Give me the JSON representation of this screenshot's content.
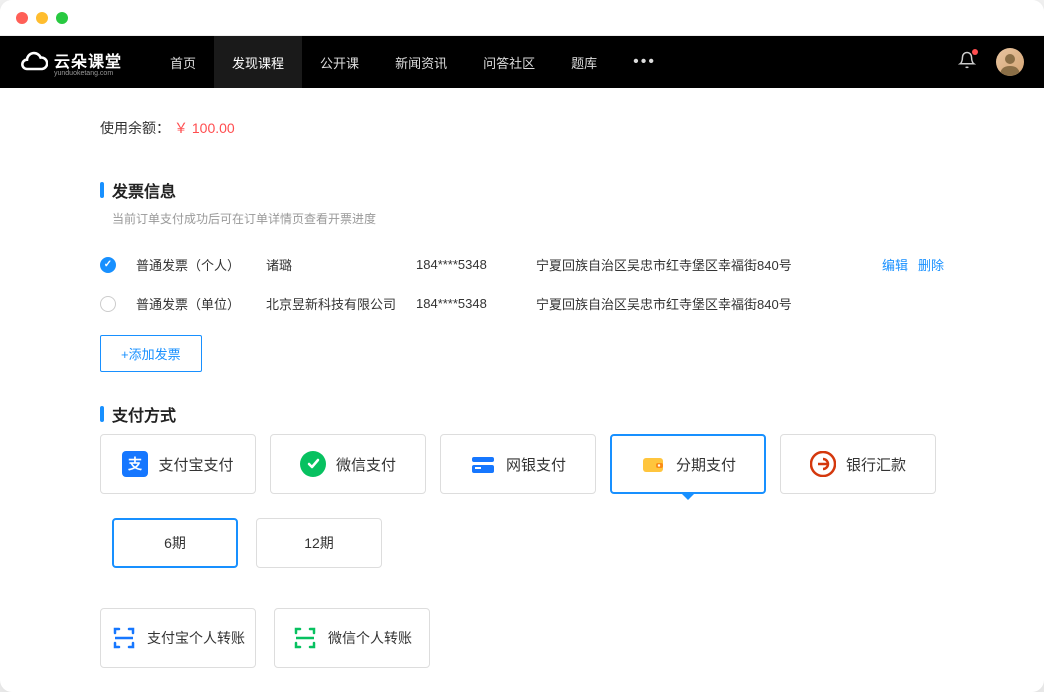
{
  "header": {
    "logo_text": "云朵课堂",
    "logo_sub": "yunduoketang.com",
    "nav": [
      "首页",
      "发现课程",
      "公开课",
      "新闻资讯",
      "问答社区",
      "题库"
    ],
    "nav_active": 1
  },
  "balance": {
    "label": "使用余额：",
    "value": "￥ 100.00"
  },
  "invoice": {
    "title": "发票信息",
    "subtitle": "当前订单支付成功后可在订单详情页查看开票进度",
    "rows": [
      {
        "type": "普通发票（个人）",
        "name": "诸璐",
        "phone": "184****5348",
        "addr": "宁夏回族自治区吴忠市红寺堡区幸福街840号",
        "checked": true,
        "show_actions": true
      },
      {
        "type": "普通发票（单位）",
        "name": "北京昱新科技有限公司",
        "phone": "184****5348",
        "addr": "宁夏回族自治区吴忠市红寺堡区幸福街840号",
        "checked": false,
        "show_actions": false
      }
    ],
    "edit_label": "编辑",
    "delete_label": "删除",
    "add_label": "+添加发票"
  },
  "payment": {
    "title": "支付方式",
    "options": [
      {
        "label": "支付宝支付",
        "icon": "alipay"
      },
      {
        "label": "微信支付",
        "icon": "wechat"
      },
      {
        "label": "网银支付",
        "icon": "bank"
      },
      {
        "label": "分期支付",
        "icon": "wallet",
        "selected": true
      },
      {
        "label": "银行汇款",
        "icon": "bankwire"
      }
    ],
    "terms": [
      {
        "label": "6期",
        "selected": true
      },
      {
        "label": "12期",
        "selected": false
      }
    ],
    "transfers": [
      {
        "label": "支付宝个人转账",
        "icon": "scan-blue"
      },
      {
        "label": "微信个人转账",
        "icon": "scan-green"
      }
    ]
  }
}
